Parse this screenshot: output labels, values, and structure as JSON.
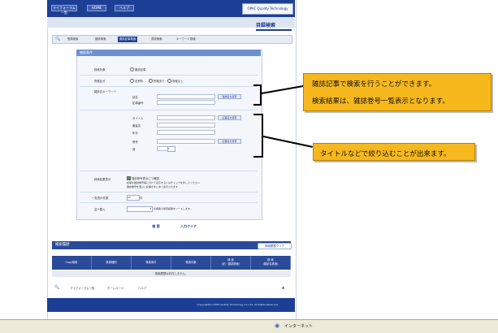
{
  "topbar": {
    "nav": [
      "マイフォーラム一覧",
      "HOME",
      "ヘルプ"
    ],
    "logo": "OPAC Quality Technology"
  },
  "page_title": "目録検索",
  "tabs": [
    "簡易検索",
    "雑誌検索",
    "雑誌記事検索",
    "書誌検索",
    "キーワード検索"
  ],
  "form": {
    "header": "検索条件",
    "rows": {
      "search_target_label": "検索対象",
      "search_target_option": "雑誌記事",
      "ndc_label": "所蔵区分",
      "ndc_options": [
        "全資料",
        "所蔵あり",
        "所蔵なし"
      ],
      "journal_keyword_label": "雑誌名キーワード",
      "journal_fields": [
        "誌名",
        "記事番号"
      ],
      "journal_lookup": "雑誌名を探索",
      "article_fields": [
        "タイトル",
        "著者名",
        "年次",
        "巻号",
        "頁"
      ],
      "article_lookup": "記事名を探索",
      "display_label": "検索結果表示",
      "display_note_1": "雑誌巻号表示にて確認",
      "display_note_2": "記事を雑誌巻号毎に分けて表示するにはチェックを外してください",
      "display_note_3": "雑誌巻号を選ぶと記事がまとめて表示されます",
      "count_label": "一覧表示件数",
      "count_value": "20",
      "count_unit": "件",
      "sort_label": "並べ替え",
      "sort_note": "の順番で検索結果をソートします。"
    }
  },
  "buttons": {
    "search": "検 索",
    "clear": "入力クリア"
  },
  "history": {
    "title": "検索履歴",
    "clear": "検索履歴クリア",
    "columns": [
      "Copy検索",
      "検索種別",
      "検索条件",
      "検索件数",
      "検 索\n(記・雑誌検索)",
      "検 索\n(雑誌名検索)"
    ],
    "empty": "検索履歴は存在しません。"
  },
  "bottom_nav": [
    "マイフォーラム一覧",
    "ホームページ",
    "ヘルプ"
  ],
  "footer": "Copyright(C) 2009 Quality Technology Co.,Ltd. All Rights Reserved.",
  "statusbar": "インターネット",
  "callouts": {
    "top_line_1": "雑誌記事で検索を行うことができます。",
    "top_line_2": "検索結果は、雑誌巻号一覧表示となります。",
    "bottom": "タイトルなどで絞り込むことが出来ます。"
  }
}
